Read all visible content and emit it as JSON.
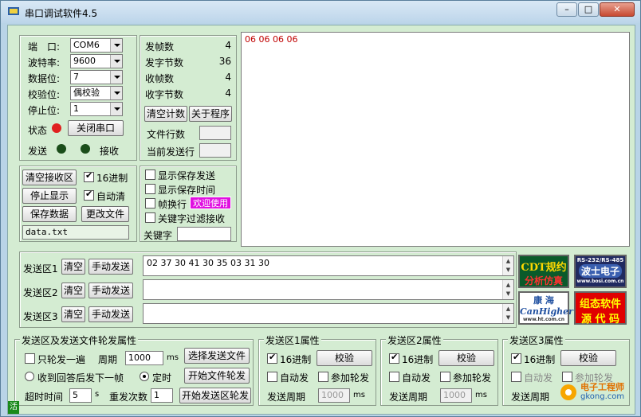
{
  "window": {
    "title": "串口调试软件4.5",
    "min": "–",
    "max": "□",
    "close": "✕"
  },
  "port": {
    "port_label": "端　口:",
    "port_value": "COM6",
    "baud_label": "波特率:",
    "baud_value": "9600",
    "data_label": "数据位:",
    "data_value": "7",
    "parity_label": "校验位:",
    "parity_value": "偶校验",
    "stop_label": "停止位:",
    "stop_value": "1",
    "status_label": "状态",
    "close_port_button": "关闭串口",
    "send_label": "发送",
    "recv_label": "接收",
    "status_color": "#e02020",
    "led_color": "#1a4d1a"
  },
  "counters": {
    "sent_frames_label": "发帧数",
    "sent_frames": "4",
    "sent_bytes_label": "发字节数",
    "sent_bytes": "36",
    "recv_frames_label": "收帧数",
    "recv_frames": "4",
    "recv_bytes_label": "收字节数",
    "recv_bytes": "4",
    "clear_count_button": "清空计数",
    "about_button": "关于程序",
    "file_lines_label": "文件行数",
    "current_line_label": "当前发送行"
  },
  "receive": {
    "content": "06 06 06 06",
    "text_color": "#c00000"
  },
  "recv_controls": {
    "clear_recv_button": "清空接收区",
    "hex_label": "16进制",
    "stop_display_button": "停止显示",
    "auto_clear_label": "自动清",
    "save_data_button": "保存数据",
    "change_file_button": "更改文件",
    "file_name": "data.txt"
  },
  "display_options": {
    "show_saved_send": "显示保存发送",
    "show_saved_time": "显示保存时间",
    "frame_newline": "帧换行",
    "welcome": "欢迎使用",
    "keyword_filter": "关键字过滤接收",
    "keyword_label": "关键字"
  },
  "send_areas": [
    {
      "label": "发送区1",
      "clear": "清空",
      "manual": "手动发送",
      "content": "02 37 30 41 30 35 03 31 30"
    },
    {
      "label": "发送区2",
      "clear": "清空",
      "manual": "手动发送",
      "content": ""
    },
    {
      "label": "发送区3",
      "clear": "清空",
      "manual": "手动发送",
      "content": ""
    }
  ],
  "ads": [
    {
      "line1": "CDT规约",
      "line2": "分析仿真"
    },
    {
      "line1": "RS-232/RS-485",
      "line2": "波士电子",
      "line3": "www.bosi.com.cn"
    },
    {
      "line1": "康 海",
      "line2": "CanHigher",
      "line3": "www.ht.com.cn"
    },
    {
      "line1": "组态软件",
      "line2": "源 代 码"
    }
  ],
  "loop_group": {
    "title": "发送区及发送文件轮发属性",
    "only_once": "只轮发一遍",
    "period_label": "周期",
    "period_value": "1000",
    "ms": "ms",
    "choose_file_button": "选择发送文件",
    "after_reply": "收到回答后发下一帧",
    "timed": "定时",
    "start_file_loop_button": "开始文件轮发",
    "timeout_label": "超时时间",
    "timeout_value": "5",
    "s": "s",
    "resend_label": "重发次数",
    "resend_value": "1",
    "start_area_loop_button": "开始发送区轮发"
  },
  "area_props": [
    {
      "title": "发送区1属性",
      "hex": "16进制",
      "check_button": "校验",
      "auto_send": "自动发",
      "add_loop": "参加轮发",
      "period_label": "发送周期",
      "period_value": "1000",
      "ms": "ms"
    },
    {
      "title": "发送区2属性",
      "hex": "16进制",
      "check_button": "校验",
      "auto_send": "自动发",
      "add_loop": "参加轮发",
      "period_label": "发送周期",
      "period_value": "1000",
      "ms": "ms"
    },
    {
      "title": "发送区3属性",
      "hex": "16进制",
      "check_button": "校验",
      "auto_send": "自动发",
      "add_loop": "参加轮发",
      "period_label": "发送周期"
    }
  ],
  "status_bar": {
    "text": "活"
  },
  "watermark": {
    "line1": "电子工程师",
    "line2": "gkong.com"
  }
}
